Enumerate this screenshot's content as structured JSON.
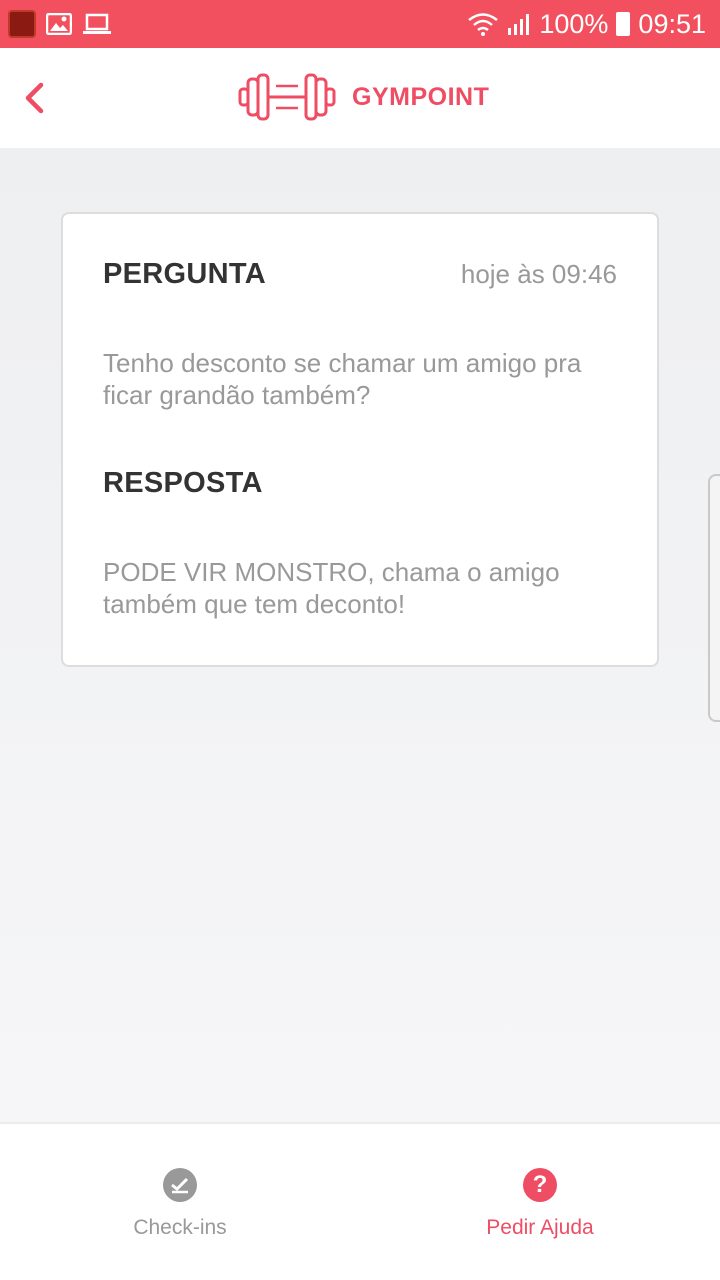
{
  "status_bar": {
    "battery": "100%",
    "time": "09:51",
    "icons": [
      "app-icon",
      "gallery-icon",
      "laptop-icon",
      "wifi-icon",
      "signal-icon",
      "battery-icon"
    ]
  },
  "header": {
    "brand": "GYMPOINT",
    "logo_icon": "dumbbell-icon",
    "back_icon": "chevron-left-icon"
  },
  "card": {
    "question_label": "PERGUNTA",
    "question_time": "hoje às 09:46",
    "question_text": "Tenho desconto se chamar um amigo pra ficar grandão também?",
    "answer_label": "RESPOSTA",
    "answer_text": "PODE VIR MONSTRO, chama o amigo também que tem deconto!"
  },
  "tabbar": {
    "checkins_label": "Check-ins",
    "help_label": "Pedir Ajuda",
    "active_tab": "Pedir Ajuda"
  },
  "colors": {
    "brand": "#ee4d64",
    "status_bar": "#f2505f",
    "inactive": "#999999"
  }
}
